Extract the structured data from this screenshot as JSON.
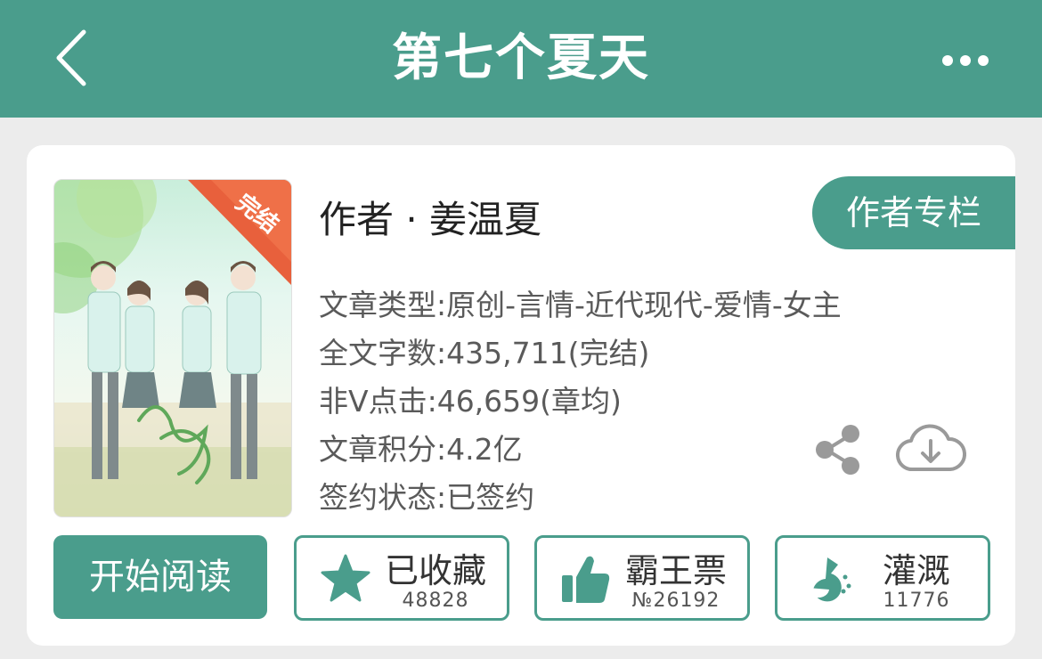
{
  "header": {
    "title": "第七个夏天"
  },
  "book": {
    "cover_badge": "完结",
    "author": "作者 · 姜温夏",
    "column_button": "作者专栏",
    "info": [
      "文章类型:原创-言情-近代现代-爱情-女主",
      "全文字数:435,711(完结)",
      "非V点击:46,659(章均)",
      "文章积分:4.2亿",
      "签约状态:已签约"
    ]
  },
  "actions": {
    "read_label": "开始阅读",
    "favorite": {
      "label": "已收藏",
      "count": "48828"
    },
    "vote": {
      "label": "霸王票",
      "count": "№26192"
    },
    "nutrient": {
      "label": "灌溉",
      "count": "11776"
    }
  },
  "colors": {
    "accent": "#4a9d8c",
    "badge": "#e8603c"
  }
}
